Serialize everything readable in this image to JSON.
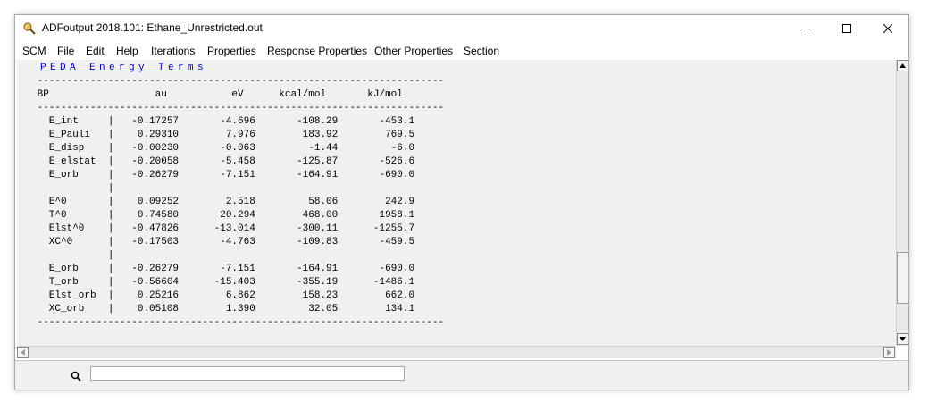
{
  "window": {
    "title": "ADFoutput 2018.101: Ethane_Unrestricted.out"
  },
  "menu": {
    "items": [
      "SCM",
      "File",
      "Edit",
      "Help",
      "Iterations",
      "Properties",
      "Response Properties",
      "Other Properties",
      "Section"
    ]
  },
  "section": {
    "link_text": "PEDA Energy Terms"
  },
  "output": {
    "text": " ---------------------------------------------------------------------\n BP                  au           eV      kcal/mol       kJ/mol\n ---------------------------------------------------------------------\n   E_int     |   -0.17257       -4.696       -108.29       -453.1\n   E_Pauli   |    0.29310        7.976        183.92        769.5\n   E_disp    |   -0.00230       -0.063         -1.44         -6.0\n   E_elstat  |   -0.20058       -5.458       -125.87       -526.6\n   E_orb     |   -0.26279       -7.151       -164.91       -690.0\n             |\n   E^0       |    0.09252        2.518         58.06        242.9\n   T^0       |    0.74580       20.294        468.00       1958.1\n   Elst^0    |   -0.47826      -13.014       -300.11      -1255.7\n   XC^0      |   -0.17503       -4.763       -109.83       -459.5\n             |\n   E_orb     |   -0.26279       -7.151       -164.91       -690.0\n   T_orb     |   -0.56604      -15.403       -355.19      -1486.1\n   Elst_orb  |    0.25216        6.862        158.23        662.0\n   XC_orb    |    0.05108        1.390         32.05        134.1\n ---------------------------------------------------------------------"
  },
  "search": {
    "value": ""
  },
  "icons": {
    "app": "magnifier-app-icon",
    "search": "search-icon",
    "minimize": "minimize-icon",
    "maximize": "maximize-icon",
    "close": "close-icon"
  }
}
